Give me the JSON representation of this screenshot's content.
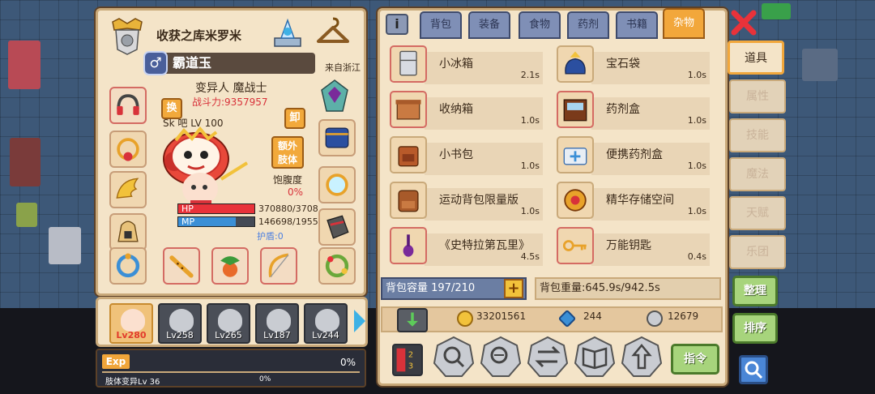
{
  "character": {
    "title": "收获之库米罗米",
    "name": "霸道玉",
    "gender_symbol": "♂",
    "origin": "来自浙江",
    "class": "变异人 魔战士",
    "power": "战斗力:9357957",
    "swap_label": "换",
    "unload_label": "卸",
    "extra_limb_label_1": "额外",
    "extra_limb_label_2": "肢体",
    "hunger_label": "饱腹度",
    "hunger_value": "0%",
    "level_overlay": "Sk 吧 LV 100",
    "hp_label": "HP",
    "hp_value": "370880/3708",
    "hp_fraction": 1.0,
    "mp_label": "MP",
    "mp_value": "146698/1955",
    "mp_fraction": 0.75,
    "shield": "护盾:0"
  },
  "pets": [
    {
      "level": "Lv280",
      "active": true
    },
    {
      "level": "Lv258",
      "active": false
    },
    {
      "level": "Lv265",
      "active": false
    },
    {
      "level": "Lv187",
      "active": false
    },
    {
      "level": "Lv244",
      "active": false
    }
  ],
  "exp": {
    "tag": "Exp",
    "percent": "0%",
    "sub_label": "肢体变异Lv 36",
    "sub_percent": "0%"
  },
  "inventory": {
    "info_label": "i",
    "tabs": [
      "背包",
      "装备",
      "食物",
      "药剂",
      "书籍",
      "杂物"
    ],
    "active_tab": "杂物",
    "items": [
      {
        "name": "小冰箱",
        "time": "2.1s",
        "icon": "fridge-icon"
      },
      {
        "name": "宝石袋",
        "time": "1.0s",
        "icon": "gem-bag-icon"
      },
      {
        "name": "收纳箱",
        "time": "1.0s",
        "icon": "storage-box-icon"
      },
      {
        "name": "药剂盒",
        "time": "1.0s",
        "icon": "potion-box-icon"
      },
      {
        "name": "小书包",
        "time": "1.0s",
        "icon": "small-backpack-icon"
      },
      {
        "name": "便携药剂盒",
        "time": "1.0s",
        "icon": "portable-potion-box-icon"
      },
      {
        "name": "运动背包限量版",
        "time": "1.0s",
        "icon": "sport-backpack-icon"
      },
      {
        "name": "精华存储空间",
        "time": "1.0s",
        "icon": "essence-storage-icon"
      },
      {
        "name": "《史特拉第瓦里》",
        "time": "4.5s",
        "icon": "violin-book-icon"
      },
      {
        "name": "万能钥匙",
        "time": "0.4s",
        "icon": "master-key-icon"
      }
    ],
    "capacity": "背包容量 197/210",
    "weight": "背包重量:645.9s/942.5s",
    "gold": "33201561",
    "gems": "244",
    "silver": "12679",
    "command_label": "指令"
  },
  "side_tabs": [
    "道具",
    "属性",
    "技能",
    "魔法",
    "天赋",
    "乐团"
  ],
  "active_side_tab": "道具",
  "buttons": {
    "arrange": "整理",
    "sort": "排序"
  },
  "colors": {
    "panel_bg": "#f4e4c8",
    "tab_active": "#f2a73b",
    "hp": "#e8323a",
    "mp": "#3b8fd6",
    "button_green": "#a7d47c"
  }
}
